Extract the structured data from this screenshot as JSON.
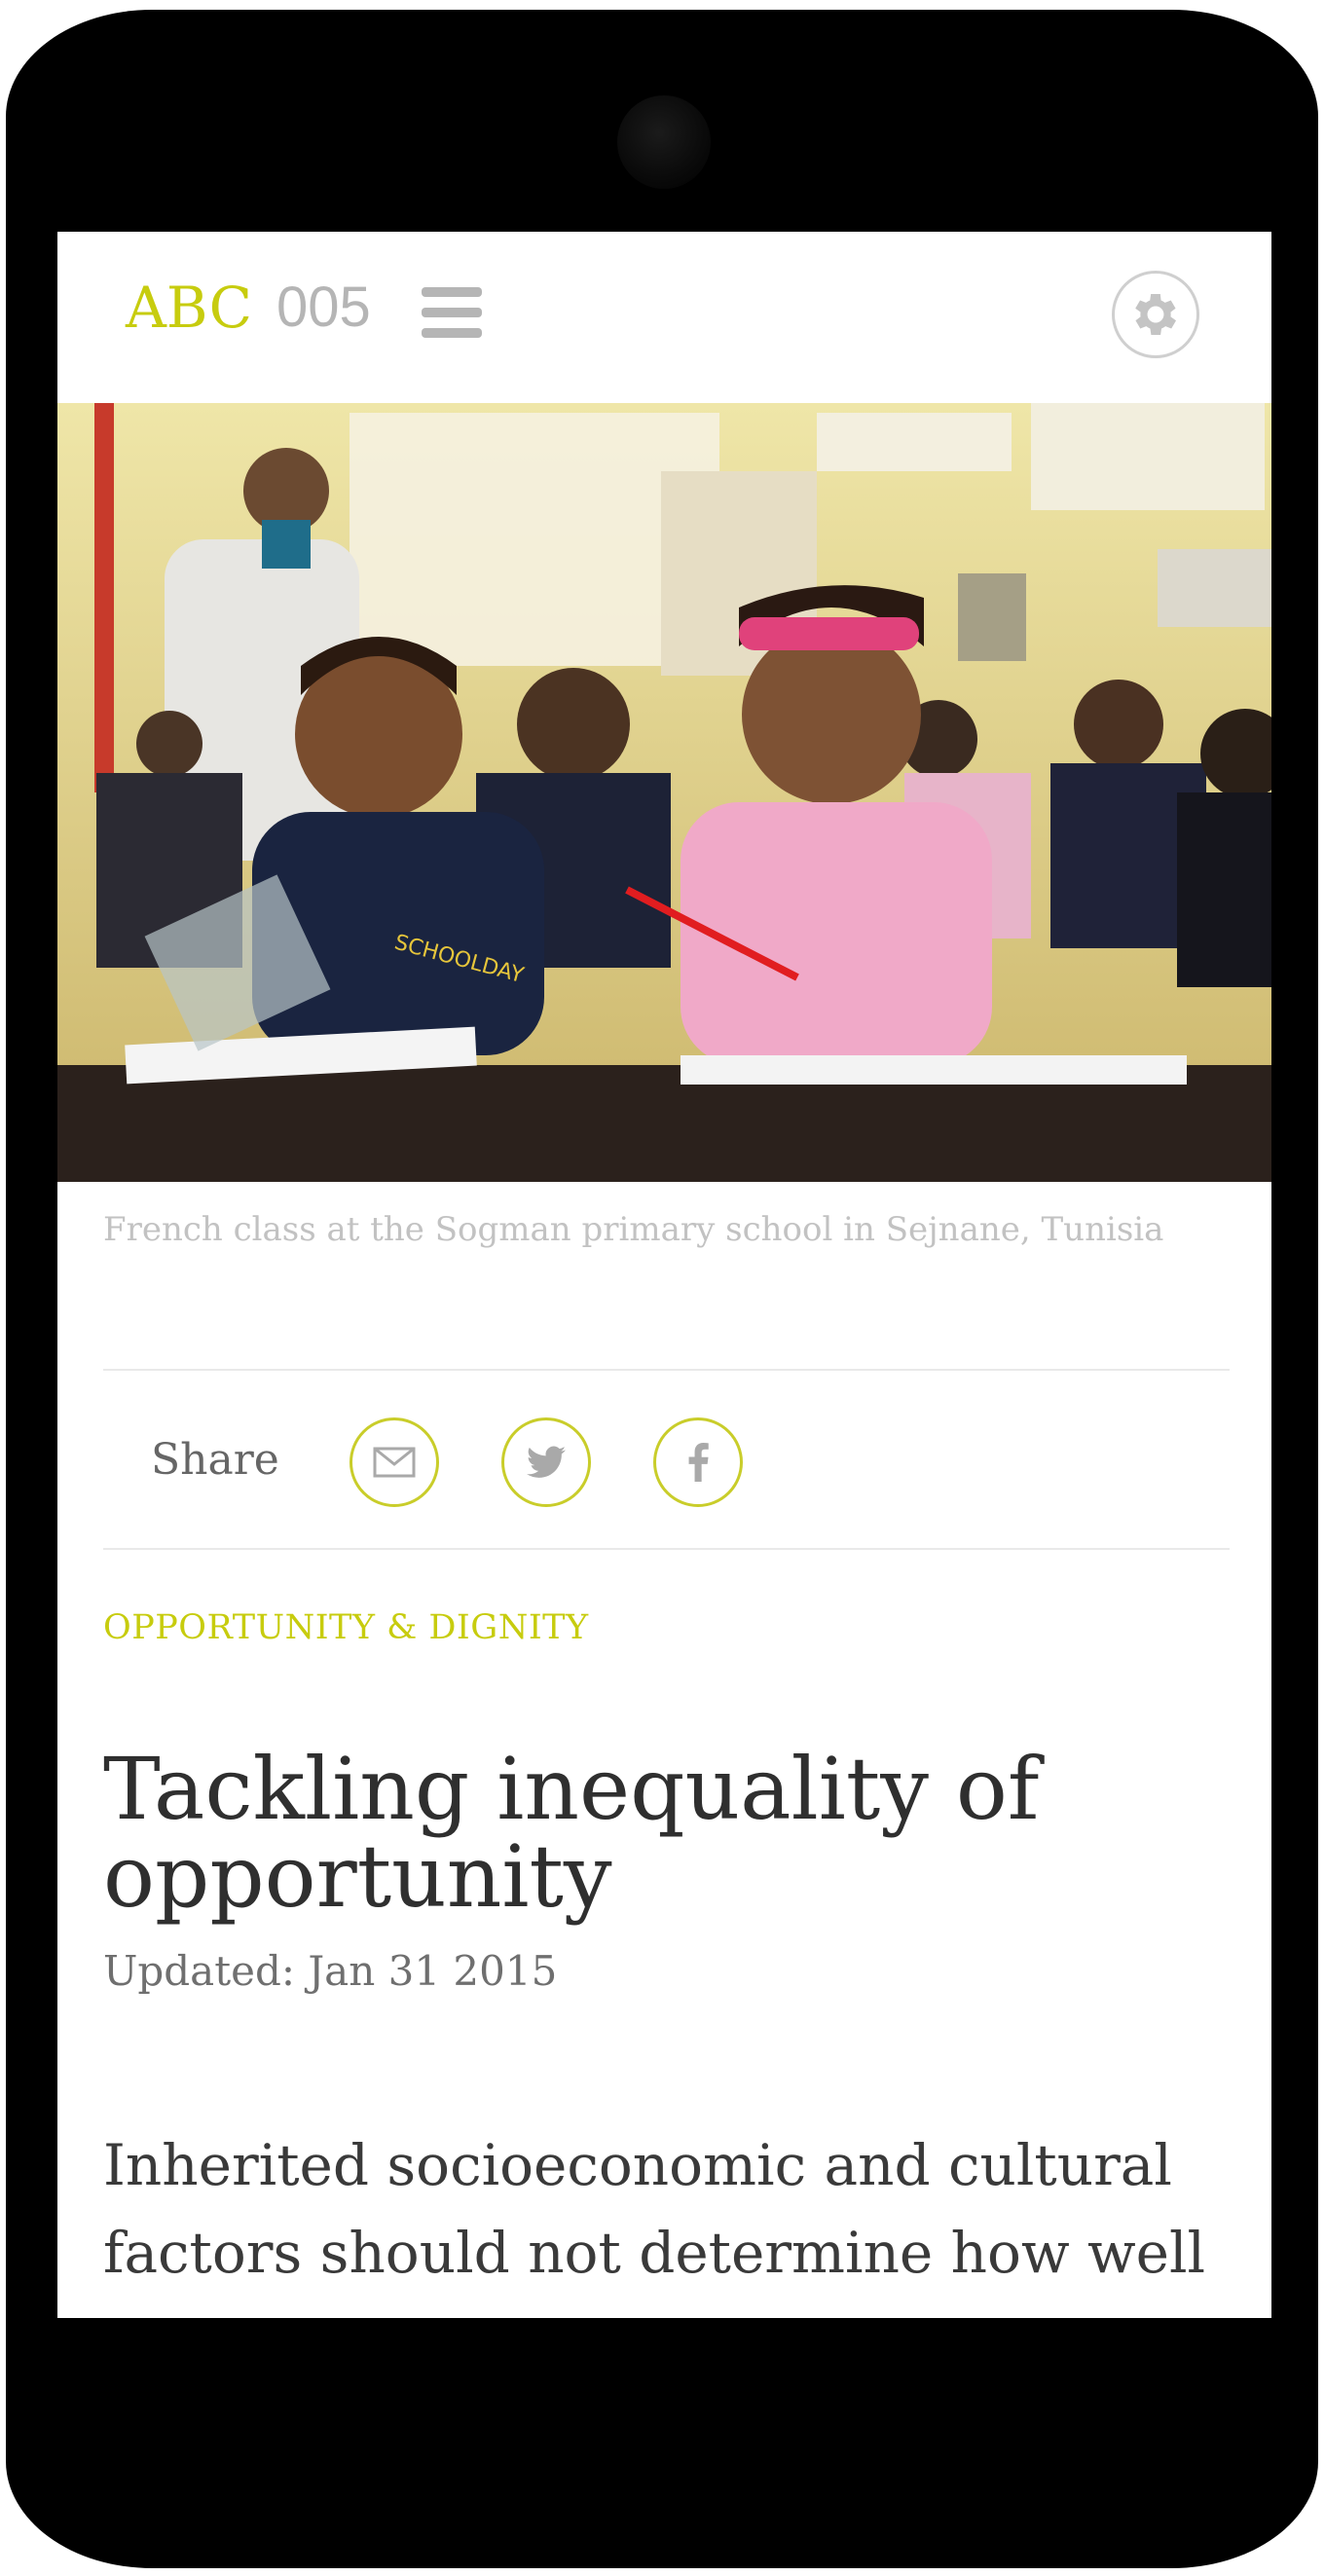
{
  "app": {
    "logo_brand": "ABC",
    "logo_number": "005"
  },
  "hero": {
    "image_caption": "French class at the Sogman primary school in Sejnane, Tunisia",
    "shirt_text": "SCHOOLDAY"
  },
  "share": {
    "label": "Share",
    "buttons": [
      {
        "icon": "mail-icon"
      },
      {
        "icon": "twitter-icon"
      },
      {
        "icon": "facebook-icon"
      }
    ]
  },
  "article": {
    "category": "OPPORTUNITY & DIGNITY",
    "title": "Tackling inequality of opportunity",
    "updated": "Updated: Jan 31 2015",
    "lede": "Inherited socioeconomic and cultural factors should not determine how well"
  },
  "colors": {
    "accent": "#c7cc0e",
    "muted": "#b5b5b5",
    "text": "#2f2f2f",
    "device": "#000000"
  }
}
